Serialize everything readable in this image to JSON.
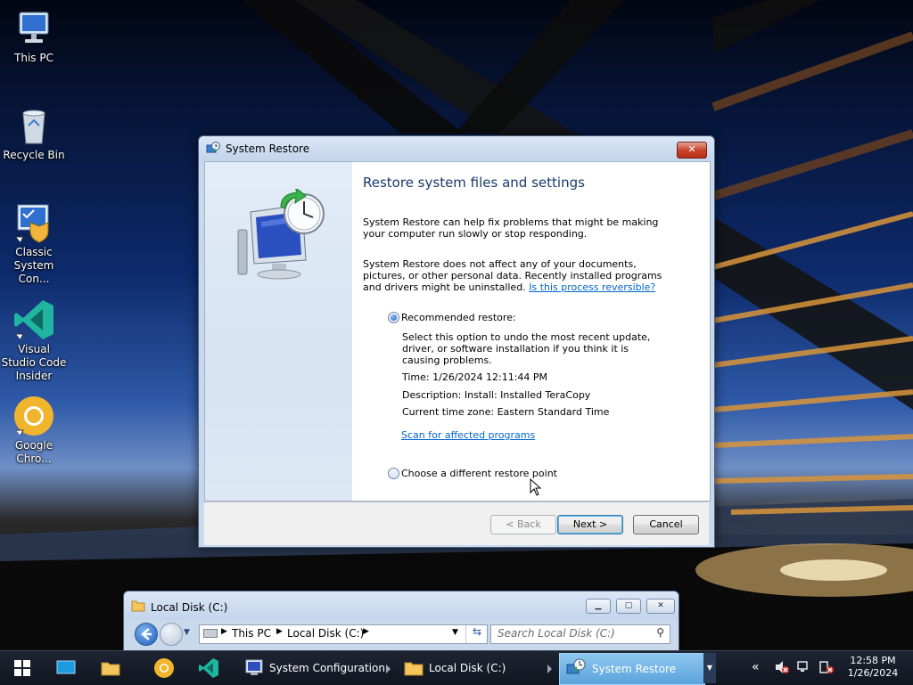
{
  "desktop": {
    "icons": [
      {
        "label": "This PC"
      },
      {
        "label": "Recycle Bin"
      },
      {
        "label": "Classic System Con..."
      },
      {
        "label": "Visual Studio Code Insider"
      },
      {
        "label": "Google Chro..."
      }
    ]
  },
  "restore_dialog": {
    "title": "System Restore",
    "close_label": "✕",
    "heading": "Restore system files and settings",
    "para1": "System Restore can help fix problems that might be making your computer run slowly or stop responding.",
    "para2": "System Restore does not affect any of your documents, pictures, or other personal data. Recently installed programs and drivers might be uninstalled.",
    "para2_link": "Is this process reversible?",
    "recommended_label": "Recommended restore:",
    "recommended_desc": "Select this option to undo the most recent update, driver, or software installation if you think it is causing problems.",
    "time": "Time: 1/26/2024 12:11:44 PM",
    "description": "Description: Install: Installed TeraCopy",
    "timezone": "Current time zone: Eastern Standard Time",
    "scan_link": "Scan for affected programs",
    "different_label": "Choose a different restore point",
    "back_label": "< Back",
    "next_label": "Next >",
    "cancel_label": "Cancel"
  },
  "explorer": {
    "title": "Local Disk (C:)",
    "breadcrumb": [
      "This PC",
      "Local Disk (C:)"
    ],
    "search_placeholder": "Search Local Disk (C:)"
  },
  "taskbar": {
    "apps": [
      {
        "label": "System Configuration"
      },
      {
        "label": "Local Disk (C:)"
      },
      {
        "label": "System Restore"
      }
    ],
    "time": "12:58 PM",
    "date": "1/26/2024"
  }
}
